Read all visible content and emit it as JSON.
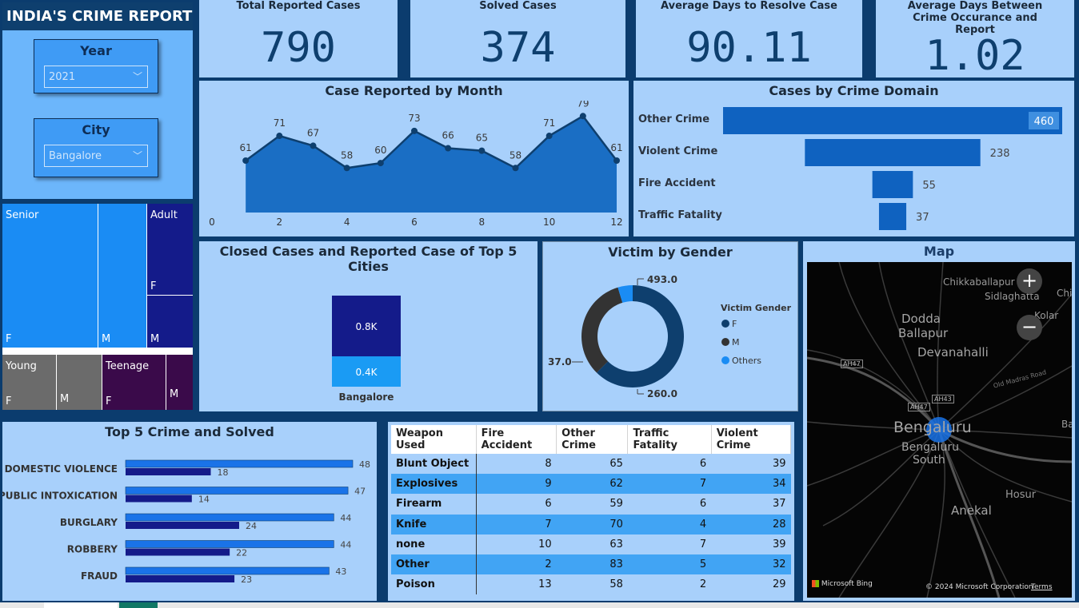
{
  "report_title": "INDIA'S CRIME REPORT",
  "slicers": {
    "year": {
      "title": "Year",
      "value": "2021"
    },
    "city": {
      "title": "City",
      "value": "Bangalore"
    }
  },
  "kpis": [
    {
      "title": "Total Reported Cases",
      "value": "790"
    },
    {
      "title": "Solved Cases",
      "value": "374"
    },
    {
      "title": "Average Days to Resolve Case",
      "value": "90.11"
    },
    {
      "title": "Average Days Between Crime Occurance and Report",
      "value": "1.02"
    }
  ],
  "treemap": {
    "groups": [
      {
        "name": "Senior",
        "labels": [
          "F",
          "M"
        ]
      },
      {
        "name": "Adult",
        "labels": [
          "F",
          "M"
        ]
      },
      {
        "name": "Young",
        "labels": [
          "F",
          "M"
        ]
      },
      {
        "name": "Teenage",
        "labels": [
          "F",
          "M"
        ]
      }
    ]
  },
  "weapons_table": {
    "headers": [
      "Weapon Used",
      "Fire Accident",
      "Other Crime",
      "Traffic Fatality",
      "Violent Crime"
    ],
    "rows": [
      [
        "Blunt Object",
        "8",
        "65",
        "6",
        "39"
      ],
      [
        "Explosives",
        "9",
        "62",
        "7",
        "34"
      ],
      [
        "Firearm",
        "6",
        "59",
        "6",
        "37"
      ],
      [
        "Knife",
        "7",
        "70",
        "4",
        "28"
      ],
      [
        "none",
        "10",
        "63",
        "7",
        "39"
      ],
      [
        "Other",
        "2",
        "83",
        "5",
        "32"
      ],
      [
        "Poison",
        "13",
        "58",
        "2",
        "29"
      ]
    ]
  },
  "map": {
    "title": "Map",
    "places": [
      "Chikkaballapur",
      "Sidlaghatta",
      "Chi",
      "Kolar",
      "Dodda",
      "Ballapur",
      "Devanahalli",
      "Bengaluru",
      "Bengaluru",
      "South",
      "Hosur",
      "Anekal",
      "Ba"
    ],
    "roads": [
      "AH47",
      "AH47",
      "AH43",
      "Old Madras Road"
    ],
    "attribution": "© 2024 Microsoft Corporation",
    "terms": "Terms",
    "bing": "Microsoft Bing",
    "zoom_in": "+",
    "zoom_out": "−"
  },
  "colors": {
    "accent": "#1565c0",
    "panel": "#a8d0fb",
    "background": "#0b3c6e"
  },
  "chart_data": [
    {
      "type": "area",
      "title": "Case Reported by Month",
      "x": [
        1,
        2,
        3,
        4,
        5,
        6,
        7,
        8,
        9,
        10,
        11,
        12
      ],
      "values": [
        61,
        71,
        67,
        58,
        60,
        73,
        66,
        65,
        58,
        71,
        79,
        61
      ],
      "xticks": [
        "0",
        "2",
        "4",
        "6",
        "8",
        "10",
        "12"
      ],
      "xlim": [
        0,
        12
      ]
    },
    {
      "type": "bar",
      "orientation": "horizontal",
      "title": "Cases by Crime Domain",
      "categories": [
        "Other Crime",
        "Violent Crime",
        "Fire Accident",
        "Traffic Fatality"
      ],
      "values": [
        460,
        238,
        55,
        37
      ],
      "value_labels": [
        "460",
        "238",
        "55",
        "37"
      ]
    },
    {
      "type": "bar",
      "title": "Closed Cases and Reported Case of Top 5 Cities",
      "categories": [
        "Bangalore"
      ],
      "series": [
        {
          "values": [
            0.8
          ],
          "label": "0.8K"
        },
        {
          "values": [
            0.4
          ],
          "label": "0.4K"
        }
      ]
    },
    {
      "type": "pie",
      "title": "Victim by Gender",
      "legend_title": "Victim Gender",
      "legend": "right",
      "categories": [
        "F",
        "M",
        "Others"
      ],
      "values": [
        493.0,
        260.0,
        37.0
      ],
      "value_labels": [
        "493.0",
        "260.0",
        "37.0"
      ]
    },
    {
      "type": "bar",
      "orientation": "horizontal",
      "title": "Top 5 Crime and Solved",
      "categories": [
        "DOMESTIC VIOLENCE",
        "PUBLIC INTOXICATION",
        "BURGLARY",
        "ROBBERY",
        "FRAUD"
      ],
      "series": [
        {
          "values": [
            48,
            47,
            44,
            44,
            43
          ]
        },
        {
          "values": [
            18,
            14,
            24,
            22,
            23
          ]
        }
      ]
    }
  ]
}
